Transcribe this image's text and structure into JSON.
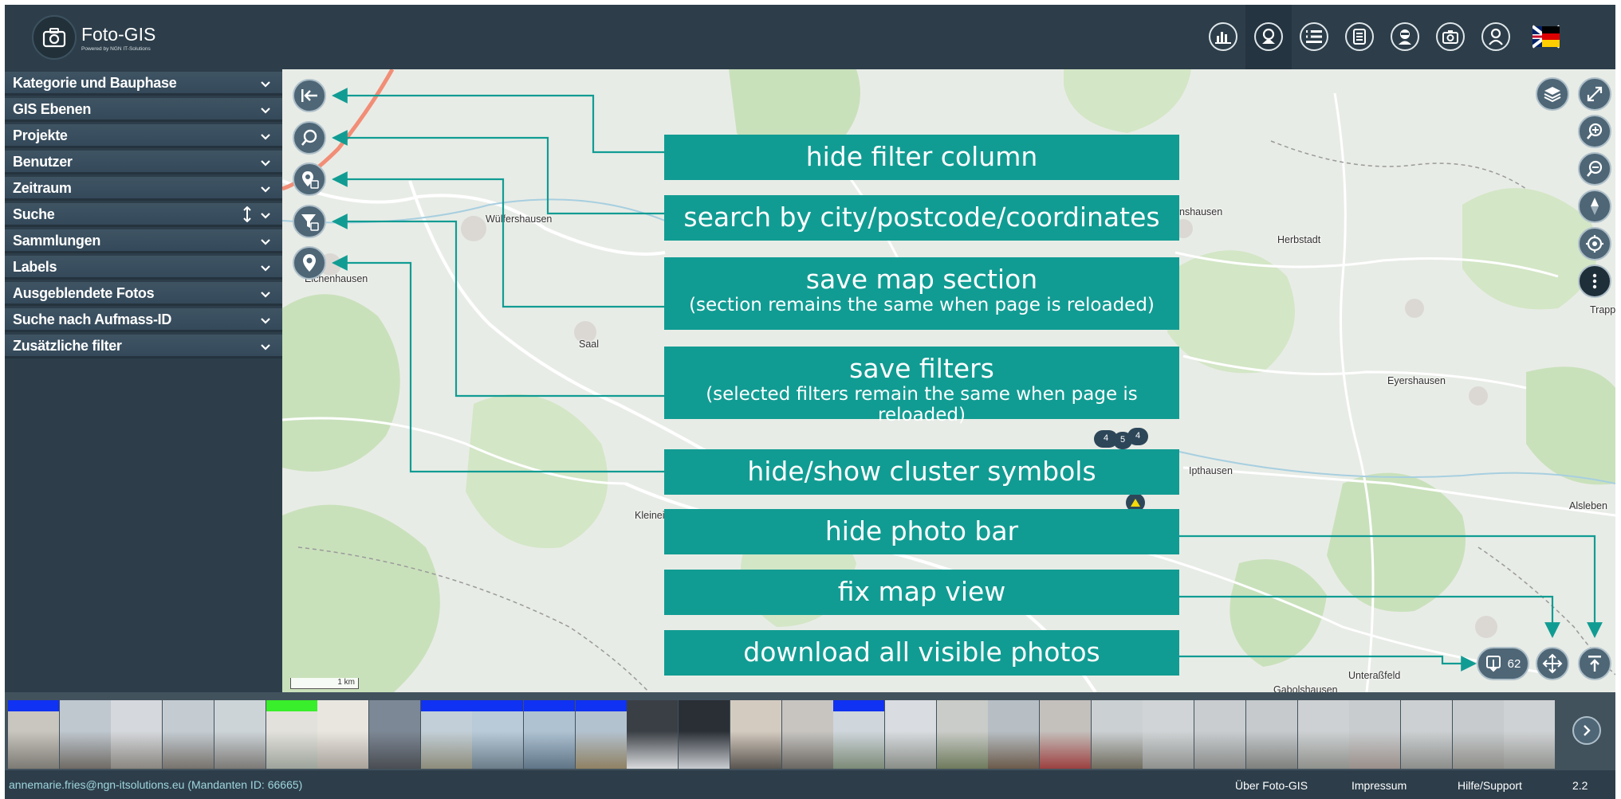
{
  "header": {
    "app_title": "Foto-GIS",
    "app_subtitle": "Powered by NGN IT-Solutions",
    "icons": [
      "statistics-icon",
      "map-photo-icon",
      "list-icon",
      "document-list-icon",
      "user-admin-icon",
      "photo-settings-icon",
      "user-icon",
      "flag-icon"
    ]
  },
  "sidebar": {
    "items": [
      {
        "label": "Kategorie und Bauphase"
      },
      {
        "label": "GIS Ebenen"
      },
      {
        "label": "Projekte"
      },
      {
        "label": "Benutzer"
      },
      {
        "label": "Zeitraum"
      },
      {
        "label": "Suche"
      },
      {
        "label": "Sammlungen"
      },
      {
        "label": "Labels"
      },
      {
        "label": "Ausgeblendete Fotos"
      },
      {
        "label": "Suche nach Aufmass-ID"
      },
      {
        "label": "Zusätzliche filter"
      }
    ]
  },
  "map": {
    "places": [
      "Wülfershausen",
      "Eichenhausen",
      "Saal",
      "Herbstadt",
      "Eyershausen",
      "Ipthausen",
      "Kleineib",
      "Alsleben",
      "Unteraßfeld",
      "Gabolshausen",
      "Trapps",
      "nshausen"
    ],
    "scale_label": "1 km",
    "cluster_counts": [
      "4",
      "5",
      "4"
    ],
    "download_count": "62"
  },
  "callouts": [
    {
      "main": "hide filter column",
      "sub": ""
    },
    {
      "main": "search by city/postcode/coordinates",
      "sub": ""
    },
    {
      "main": "save map section",
      "sub": "(section remains the same when page is reloaded)"
    },
    {
      "main": "save filters",
      "sub": "(selected filters remain the same when page is reloaded)"
    },
    {
      "main": "hide/show cluster symbols",
      "sub": ""
    },
    {
      "main": "hide photo bar",
      "sub": ""
    },
    {
      "main": "fix map view",
      "sub": ""
    },
    {
      "main": "download all visible photos",
      "sub": ""
    }
  ],
  "photobar": {
    "band_colors": [
      "#1032f2",
      "",
      "",
      "",
      "",
      "#39ee2b",
      "",
      "",
      "#1032f2",
      "#1032f2",
      "#1032f2",
      "#1032f2",
      "",
      "",
      "",
      "",
      "#1032f2"
    ]
  },
  "footer": {
    "user": "annemarie.fries@ngn-itsolutions.eu (Mandanten ID: 66665)",
    "about": "Über Foto-GIS",
    "imprint": "Impressum",
    "help": "Hilfe/Support",
    "version": "2.2"
  },
  "colors": {
    "accent": "#119c93",
    "panel": "#2d3e4a",
    "map_bg": "#e5ebe3"
  }
}
